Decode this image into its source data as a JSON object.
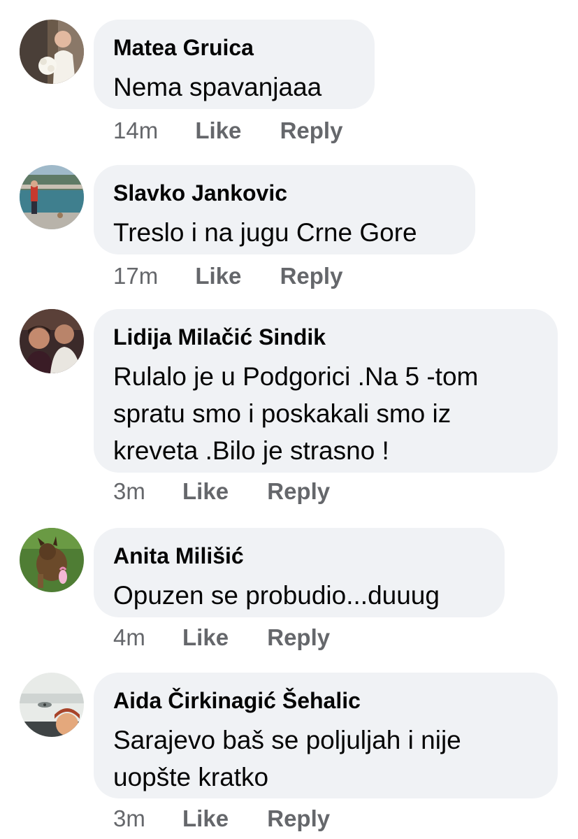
{
  "comments": [
    {
      "author": "Matea Gruica",
      "text": "Nema spavanjaaa",
      "time": "14m",
      "like_label": "Like",
      "reply_label": "Reply",
      "avatar_icon": "bride-photo-avatar"
    },
    {
      "author": "Slavko Jankovic",
      "text": "Treslo i na jugu Crne Gore",
      "time": "17m",
      "like_label": "Like",
      "reply_label": "Reply",
      "avatar_icon": "seaside-photo-avatar"
    },
    {
      "author": "Lidija Milačić Sindik",
      "text": "Rulalo je u Podgorici .Na 5 -tom\nspratu smo i poskakali smo iz\nkreveta .Bilo je strasno !",
      "time": "3m",
      "like_label": "Like",
      "reply_label": "Reply",
      "avatar_icon": "couple-photo-avatar"
    },
    {
      "author": "Anita Milišić",
      "text": "Opuzen se probudio...duuug",
      "time": "4m",
      "like_label": "Like",
      "reply_label": "Reply",
      "avatar_icon": "dog-photo-avatar"
    },
    {
      "author": "Aida Čirkinagić Šehalic",
      "text": "Sarajevo baš se poljuljah i nije\nuopšte kratko",
      "time": "3m",
      "like_label": "Like",
      "reply_label": "Reply",
      "avatar_icon": "selfie-photo-avatar"
    }
  ],
  "colors": {
    "bubble": "#f0f2f5",
    "text": "#050505",
    "meta": "#65676b"
  }
}
